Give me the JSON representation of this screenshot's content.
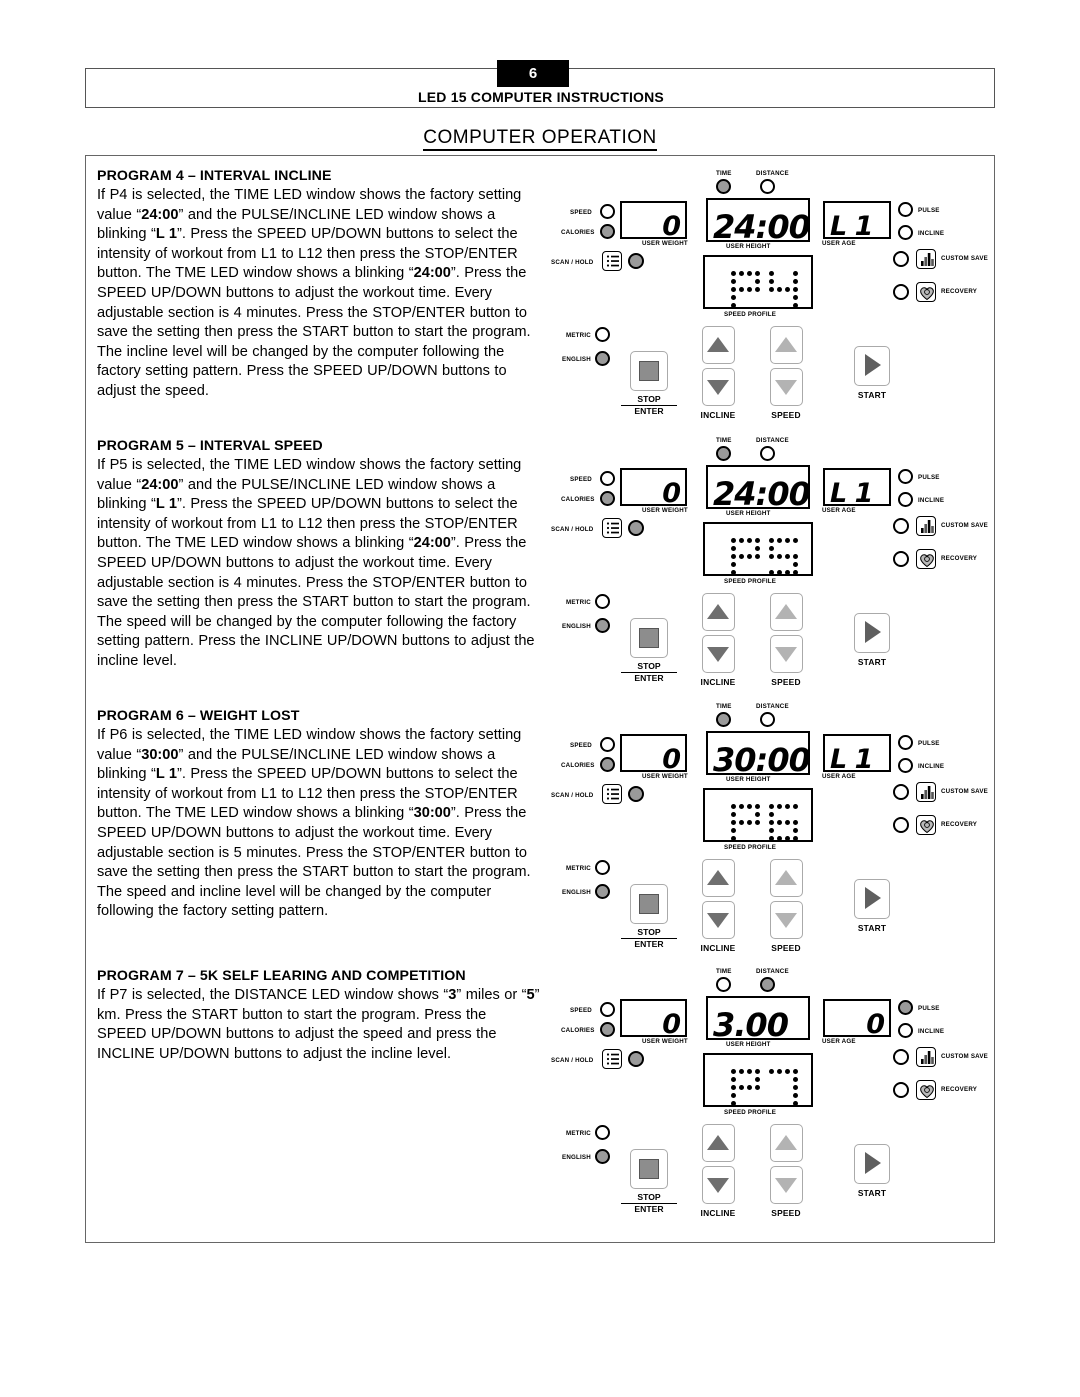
{
  "header": {
    "page_number": "6",
    "title": "LED 15 COMPUTER INSTRUCTIONS",
    "section_title": "COMPUTER OPERATION"
  },
  "programs": [
    {
      "heading": "PROGRAM 4 – INTERVAL INCLINE",
      "body_html": "If P4 is selected, the TIME LED window shows the factory setting value “<b>24:00</b>” and the PULSE/INCLINE LED window shows a blinking “<b>L 1</b>”.  Press the SPEED UP/DOWN buttons to select the intensity of workout from L1 to L12 then press the STOP/ENTER button.  The TME LED window shows a blinking “<b>24:00</b>”.  Press the SPEED UP/DOWN buttons to adjust the workout time.  Every adjustable section is 4 minutes.  Press the STOP/ENTER button to save the setting then press the START button to start the program.  The incline level will be changed by the computer following the factory setting pattern. Press the SPEED UP/DOWN buttons to adjust the speed."
    },
    {
      "heading": "PROGRAM 5 – INTERVAL SPEED",
      "body_html": "If P5 is selected, the TIME LED window shows the factory setting value “<b>24:00</b>” and the PULSE/INCLINE LED window shows a blinking “<b>L 1</b>”.  Press the SPEED UP/DOWN buttons to select the intensity of workout from L1 to L12 then press the STOP/ENTER button.  The TME LED window shows a blinking “<b>24:00</b>”.  Press the SPEED UP/DOWN buttons to adjust the workout time.  Every adjustable section is 4 minutes.  Press the STOP/ENTER button to save the setting then press the START button to start the program.  The speed will be changed by the computer following the factory setting pattern.  Press the INCLINE UP/DOWN buttons to adjust the incline level."
    },
    {
      "heading": "PROGRAM 6 – WEIGHT LOST",
      "body_html": "If P6 is selected, the TIME LED window shows the factory setting value “<b>30:00</b>” and the PULSE/INCLINE LED window shows a blinking “<b>L 1</b>”.  Press the SPEED UP/DOWN buttons to select the intensity of workout from L1 to L12 then press the STOP/ENTER button.  The TME LED window shows a blinking “<b>30:00</b>”.  Press the SPEED UP/DOWN buttons to adjust the workout time.  Every adjustable section is 5 minutes.  Press the STOP/ENTER button to save the setting then press the START button to start the program.  The speed and incline level will be changed by the computer following the factory setting pattern."
    },
    {
      "heading": "PROGRAM 7 – 5K SELF LEARING AND COMPETITION",
      "body_html": "If P7 is selected, the DISTANCE LED window shows “<b>3</b>” miles or “<b>5</b>” km.  Press the START button to start the program.  Press the SPEED UP/DOWN buttons to adjust the speed and press the INCLINE UP/DOWN buttons to adjust the incline level."
    }
  ],
  "console_labels": {
    "time": "TIME",
    "distance": "DISTANCE",
    "speed": "SPEED",
    "calories": "CALORIES",
    "scan_hold": "SCAN / HOLD",
    "user_weight": "USER WEIGHT",
    "user_height": "USER HEIGHT",
    "user_age": "USER AGE",
    "pulse": "PULSE",
    "incline": "INCLINE",
    "custom_save": "CUSTOM SAVE",
    "recovery": "RECOVERY",
    "speed_profile": "SPEED PROFILE",
    "metric": "METRIC",
    "english": "ENGLISH",
    "stop": "STOP",
    "enter": "ENTER",
    "incline_btn": "INCLINE",
    "speed_btn": "SPEED",
    "start": "START"
  },
  "consoles": [
    {
      "id": "console-program-4",
      "left_display": "0",
      "center_display": "24:00",
      "right_display": "L 1",
      "matrix_text": "P4",
      "time_on": true,
      "distance_on": false,
      "speed_on": false,
      "calories_on": true,
      "pulse_on": false,
      "incline_on": false,
      "metric_on": false,
      "english_on": true,
      "scan_hold_on": true,
      "custom_save_on": false,
      "recovery_on": false
    },
    {
      "id": "console-program-5",
      "left_display": "0",
      "center_display": "24:00",
      "right_display": "L 1",
      "matrix_text": "P5",
      "time_on": true,
      "distance_on": false,
      "speed_on": false,
      "calories_on": true,
      "pulse_on": false,
      "incline_on": false,
      "metric_on": false,
      "english_on": true,
      "scan_hold_on": true,
      "custom_save_on": false,
      "recovery_on": false
    },
    {
      "id": "console-program-6",
      "left_display": "0",
      "center_display": "30:00",
      "right_display": "L 1",
      "matrix_text": "P6",
      "time_on": true,
      "distance_on": false,
      "speed_on": false,
      "calories_on": true,
      "pulse_on": false,
      "incline_on": false,
      "metric_on": false,
      "english_on": true,
      "scan_hold_on": true,
      "custom_save_on": false,
      "recovery_on": false
    },
    {
      "id": "console-program-7",
      "left_display": "0",
      "center_display": "3.00",
      "right_display": "0",
      "matrix_text": "P7",
      "time_on": false,
      "distance_on": true,
      "speed_on": false,
      "calories_on": true,
      "pulse_on": true,
      "incline_on": false,
      "metric_on": false,
      "english_on": true,
      "scan_hold_on": true,
      "custom_save_on": false,
      "recovery_on": false
    }
  ],
  "matrix_glyphs": {
    "P": [
      [
        0,
        0
      ],
      [
        1,
        0
      ],
      [
        2,
        0
      ],
      [
        3,
        0
      ],
      [
        0,
        1
      ],
      [
        3,
        1
      ],
      [
        0,
        2
      ],
      [
        1,
        2
      ],
      [
        2,
        2
      ],
      [
        3,
        2
      ],
      [
        0,
        3
      ],
      [
        0,
        4
      ]
    ],
    "4": [
      [
        0,
        0
      ],
      [
        3,
        0
      ],
      [
        0,
        1
      ],
      [
        3,
        1
      ],
      [
        0,
        2
      ],
      [
        1,
        2
      ],
      [
        2,
        2
      ],
      [
        3,
        2
      ],
      [
        3,
        3
      ],
      [
        3,
        4
      ]
    ],
    "5": [
      [
        0,
        0
      ],
      [
        1,
        0
      ],
      [
        2,
        0
      ],
      [
        3,
        0
      ],
      [
        0,
        1
      ],
      [
        0,
        2
      ],
      [
        1,
        2
      ],
      [
        2,
        2
      ],
      [
        3,
        2
      ],
      [
        3,
        3
      ],
      [
        0,
        4
      ],
      [
        1,
        4
      ],
      [
        2,
        4
      ],
      [
        3,
        4
      ]
    ],
    "6": [
      [
        0,
        0
      ],
      [
        1,
        0
      ],
      [
        2,
        0
      ],
      [
        3,
        0
      ],
      [
        0,
        1
      ],
      [
        0,
        2
      ],
      [
        1,
        2
      ],
      [
        2,
        2
      ],
      [
        3,
        2
      ],
      [
        0,
        3
      ],
      [
        3,
        3
      ],
      [
        0,
        4
      ],
      [
        1,
        4
      ],
      [
        2,
        4
      ],
      [
        3,
        4
      ]
    ],
    "7": [
      [
        0,
        0
      ],
      [
        1,
        0
      ],
      [
        2,
        0
      ],
      [
        3,
        0
      ],
      [
        3,
        1
      ],
      [
        3,
        2
      ],
      [
        3,
        3
      ],
      [
        3,
        4
      ]
    ]
  },
  "layout": {
    "text_tops": [
      168,
      438,
      708,
      968
    ],
    "console_tops": [
      165,
      432,
      698,
      963
    ]
  }
}
